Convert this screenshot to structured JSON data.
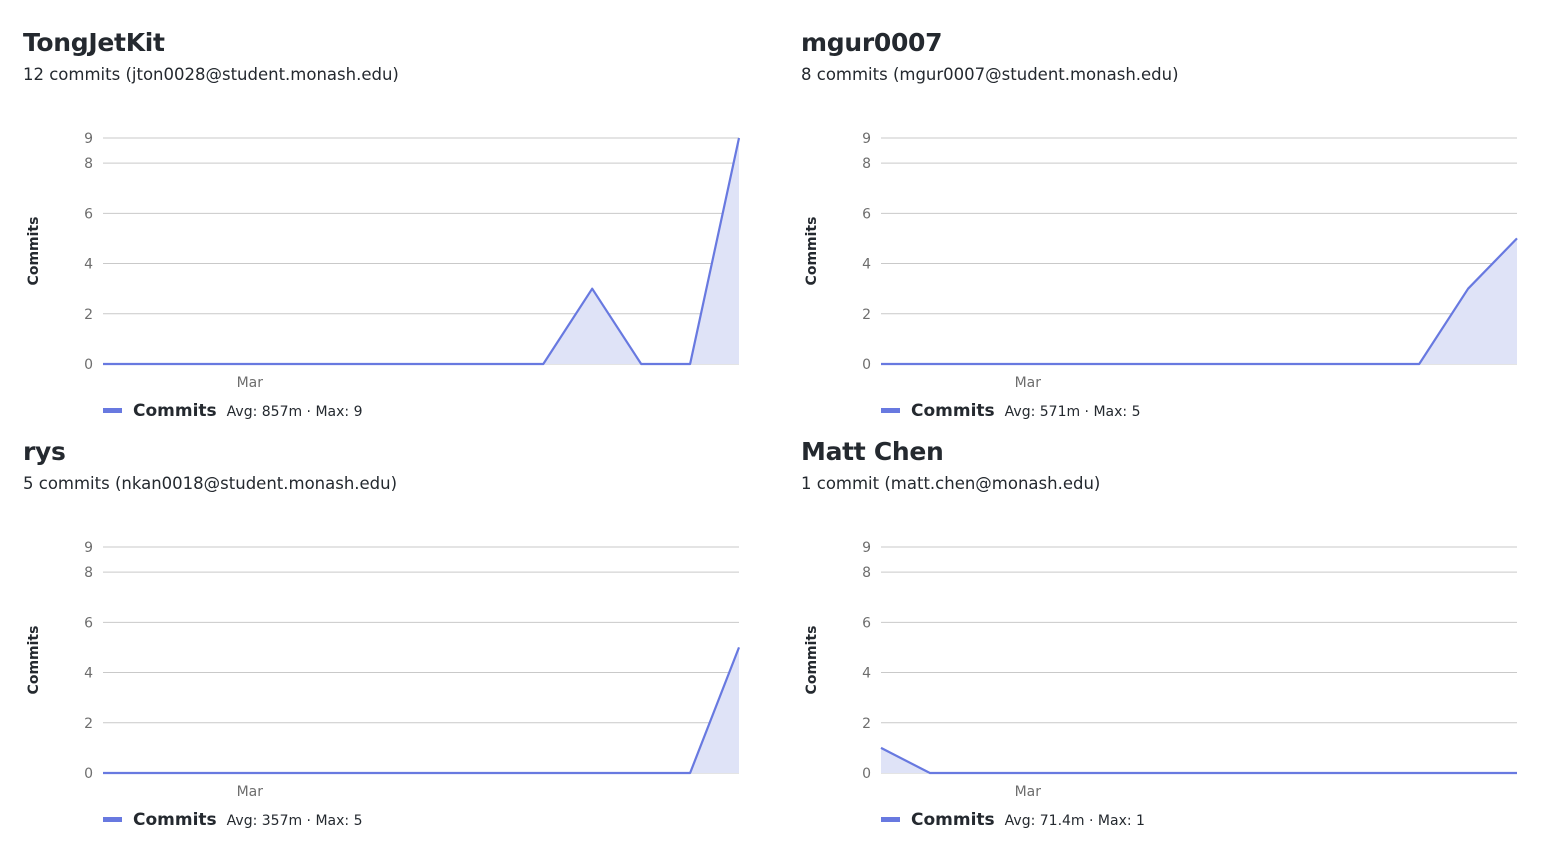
{
  "chart_data": [
    {
      "type": "area",
      "title": "TongJetKit",
      "subtitle": "12 commits (jton0028@student.monash.edu)",
      "xlabel": "",
      "ylabel": "Commits",
      "ylim": [
        0,
        9
      ],
      "yticks": [
        "0",
        "2",
        "4",
        "6",
        "8",
        "9"
      ],
      "xticks": [
        "Mar"
      ],
      "grid": true,
      "series": [
        {
          "name": "Commits",
          "color": "#6879e0",
          "fill": "#dfe3f7",
          "values": [
            0,
            0,
            0,
            0,
            0,
            0,
            0,
            0,
            0,
            0,
            3,
            0,
            0,
            9
          ],
          "legend_stats": "Avg: 857m · Max: 9"
        }
      ]
    },
    {
      "type": "area",
      "title": "mgur0007",
      "subtitle": "8 commits (mgur0007@student.monash.edu)",
      "xlabel": "",
      "ylabel": "Commits",
      "ylim": [
        0,
        9
      ],
      "yticks": [
        "0",
        "2",
        "4",
        "6",
        "8",
        "9"
      ],
      "xticks": [
        "Mar"
      ],
      "grid": true,
      "series": [
        {
          "name": "Commits",
          "color": "#6879e0",
          "fill": "#dfe3f7",
          "values": [
            0,
            0,
            0,
            0,
            0,
            0,
            0,
            0,
            0,
            0,
            0,
            0,
            3,
            5
          ],
          "legend_stats": "Avg: 571m · Max: 5"
        }
      ]
    },
    {
      "type": "area",
      "title": "rys",
      "subtitle": "5 commits (nkan0018@student.monash.edu)",
      "xlabel": "",
      "ylabel": "Commits",
      "ylim": [
        0,
        9
      ],
      "yticks": [
        "0",
        "2",
        "4",
        "6",
        "8",
        "9"
      ],
      "xticks": [
        "Mar"
      ],
      "grid": true,
      "series": [
        {
          "name": "Commits",
          "color": "#6879e0",
          "fill": "#dfe3f7",
          "values": [
            0,
            0,
            0,
            0,
            0,
            0,
            0,
            0,
            0,
            0,
            0,
            0,
            0,
            5
          ],
          "legend_stats": "Avg: 357m · Max: 5"
        }
      ]
    },
    {
      "type": "area",
      "title": "Matt Chen",
      "subtitle": "1 commit (matt.chen@monash.edu)",
      "xlabel": "",
      "ylabel": "Commits",
      "ylim": [
        0,
        9
      ],
      "yticks": [
        "0",
        "2",
        "4",
        "6",
        "8",
        "9"
      ],
      "xticks": [
        "Mar"
      ],
      "grid": true,
      "series": [
        {
          "name": "Commits",
          "color": "#6879e0",
          "fill": "#dfe3f7",
          "values": [
            1,
            0,
            0,
            0,
            0,
            0,
            0,
            0,
            0,
            0,
            0,
            0,
            0,
            0
          ],
          "legend_stats": "Avg: 71.4m · Max: 1"
        }
      ]
    }
  ]
}
